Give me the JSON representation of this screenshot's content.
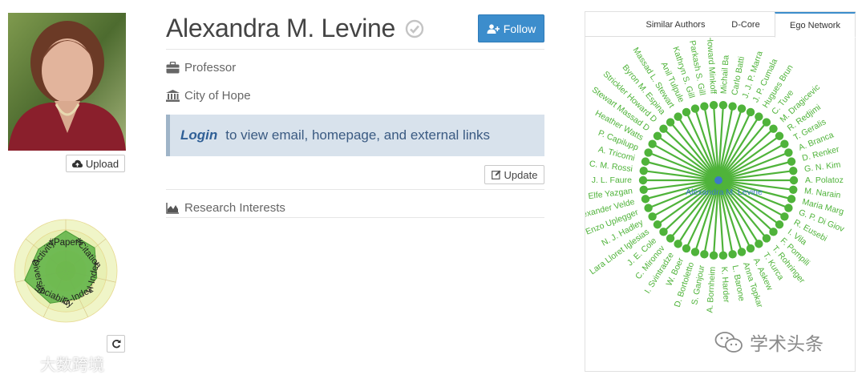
{
  "profile": {
    "name": "Alexandra M. Levine",
    "position": "Professor",
    "affiliation": "City of Hope",
    "follow_label": "Follow",
    "upload_label": "Upload",
    "update_label": "Update",
    "login_label": "Login",
    "login_text": "to view email, homepage, and external links",
    "research_interests_label": "Research Interests"
  },
  "radar": {
    "axes": [
      "#Papers",
      "#Citation",
      "H-Index",
      "G-Index",
      "Sociability",
      "Diversity",
      "Activity"
    ],
    "values": [
      0.78,
      0.72,
      0.62,
      0.6,
      0.7,
      0.82,
      0.68
    ],
    "color": "#5db346"
  },
  "tabs": [
    {
      "label": "Similar Authors",
      "active": false
    },
    {
      "label": "D-Core",
      "active": false
    },
    {
      "label": "Ego Network",
      "active": true
    }
  ],
  "ego_network": {
    "center": "Alexandra M. Levine",
    "color": "#4fb33a",
    "center_color": "#3c78c8",
    "nodes": [
      "Michail Ba",
      "Carlo Batti",
      "J. J. P. Marra",
      "J. P. Cumala",
      "Hugues Brun",
      "C. Tuve",
      "M. Dragicevic",
      "R. Redjimi",
      "T. Geralis",
      "A. Branca",
      "D. Renker",
      "G. N. Kim",
      "A. Polatoz",
      "M. Narain",
      "Maria Marg",
      "G. P. Di Giov",
      "R. Eusebi",
      "I. Vila",
      "F. Pompili",
      "T. Rohringer",
      "T. Kurca",
      "A. Askew",
      "Anna Topkar",
      "L. Barone",
      "K. Harder",
      "A. Bornheim",
      "S. Ganjour",
      "D. Bortoletto",
      "W. Boer",
      "I. Svintradze",
      "C. Mironov",
      "J. E. Cole",
      "Lara Lloret Iglesias",
      "N. J. Hadley",
      "Enzo Uplegger",
      "Alexander Velde",
      "Elfe Yazgan",
      "J. L. Faure",
      "C. M. Rossi",
      "A. Tricomi",
      "P. Capilupp",
      "Heather Watts",
      "Stewart Massad D",
      "Strickler Howard D",
      "Byron M. Espina",
      "Massad L. Stewart",
      "Anil Tulpule",
      "Kathryn S. Gill",
      "Parkash S. Gill",
      "Howard Minkoff"
    ]
  },
  "watermarks": {
    "left": "大数跨境",
    "right": "学术头条"
  }
}
